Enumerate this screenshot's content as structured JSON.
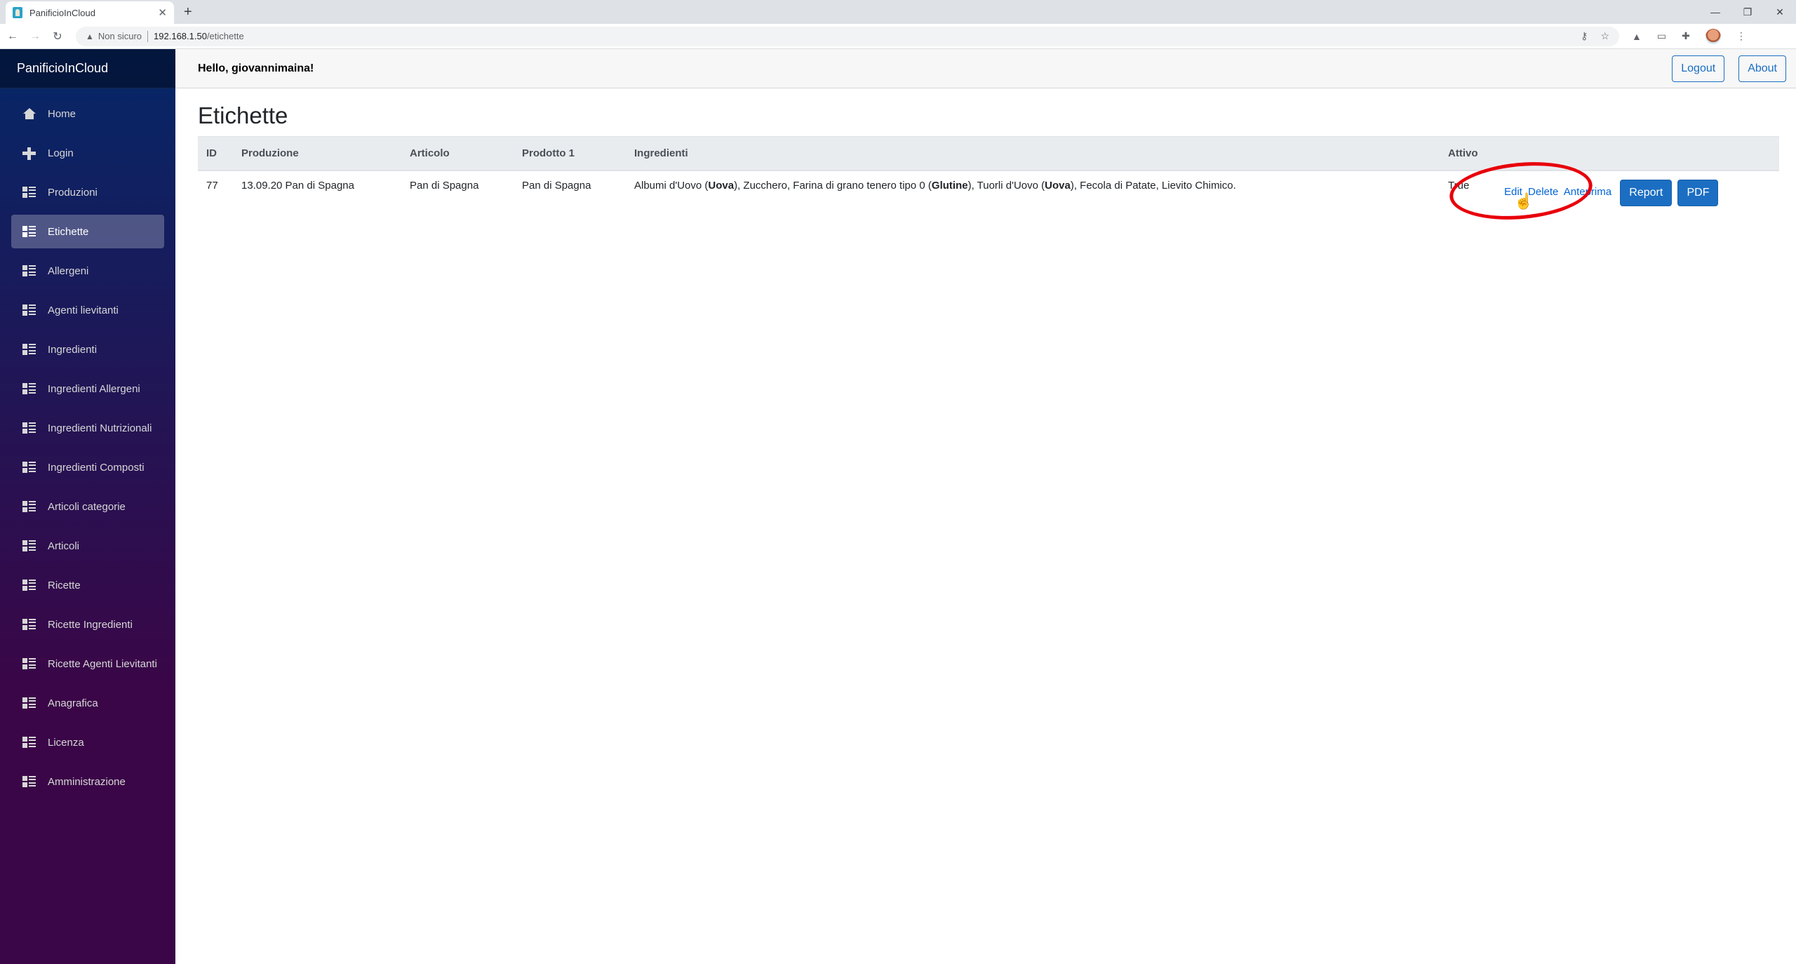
{
  "browser": {
    "tab_title": "PanificioInCloud",
    "new_tab": "+",
    "security_label": "Non sicuro",
    "url_host": "192.168.1.50",
    "url_path": "/etichette",
    "icons": [
      "key-icon",
      "star-icon",
      "drive-icon",
      "cast-icon",
      "extensions-icon",
      "profile-avatar",
      "menu-dots-icon"
    ]
  },
  "sidebar": {
    "brand": "PanificioInCloud",
    "items": [
      {
        "label": "Home",
        "icon": "home-icon",
        "active": false
      },
      {
        "label": "Login",
        "icon": "plus-icon",
        "active": false
      },
      {
        "label": "Produzioni",
        "icon": "list-icon",
        "active": false
      },
      {
        "label": "Etichette",
        "icon": "list-icon",
        "active": true
      },
      {
        "label": "Allergeni",
        "icon": "list-icon",
        "active": false
      },
      {
        "label": "Agenti lievitanti",
        "icon": "list-icon",
        "active": false
      },
      {
        "label": "Ingredienti",
        "icon": "list-icon",
        "active": false
      },
      {
        "label": "Ingredienti Allergeni",
        "icon": "list-icon",
        "active": false
      },
      {
        "label": "Ingredienti Nutrizionali",
        "icon": "list-icon",
        "active": false
      },
      {
        "label": "Ingredienti Composti",
        "icon": "list-icon",
        "active": false
      },
      {
        "label": "Articoli categorie",
        "icon": "list-icon",
        "active": false
      },
      {
        "label": "Articoli",
        "icon": "list-icon",
        "active": false
      },
      {
        "label": "Ricette",
        "icon": "list-icon",
        "active": false
      },
      {
        "label": "Ricette Ingredienti",
        "icon": "list-icon",
        "active": false
      },
      {
        "label": "Ricette Agenti Lievitanti",
        "icon": "list-icon",
        "active": false
      },
      {
        "label": "Anagrafica",
        "icon": "list-icon",
        "active": false
      },
      {
        "label": "Licenza",
        "icon": "list-icon",
        "active": false
      },
      {
        "label": "Amministrazione",
        "icon": "list-icon",
        "active": false
      }
    ]
  },
  "header": {
    "greeting": "Hello, giovannimaina!",
    "logout": "Logout",
    "about": "About"
  },
  "main": {
    "title": "Etichette",
    "table": {
      "columns": [
        "ID",
        "Produzione",
        "Articolo",
        "Prodotto 1",
        "Ingredienti",
        "Attivo",
        ""
      ],
      "rows": [
        {
          "id": "77",
          "produzione": "13.09.20 Pan di Spagna",
          "articolo": "Pan di Spagna",
          "prodotto1": "Pan di Spagna",
          "ingredienti": [
            {
              "text": "Albumi d'Uovo (",
              "bold": false
            },
            {
              "text": "Uova",
              "bold": true
            },
            {
              "text": "), Zucchero, Farina di grano tenero tipo 0 (",
              "bold": false
            },
            {
              "text": "Glutine",
              "bold": true
            },
            {
              "text": "), Tuorli d'Uovo (",
              "bold": false
            },
            {
              "text": "Uova",
              "bold": true
            },
            {
              "text": "), Fecola di Patate, Lievito Chimico.",
              "bold": false
            }
          ],
          "attivo": "True",
          "actions": {
            "edit": "Edit",
            "delete": "Delete",
            "preview": "Anteprima",
            "report": "Report",
            "pdf": "PDF"
          }
        }
      ]
    }
  },
  "colors": {
    "primary": "#1b6ec2",
    "link": "#0366d6",
    "annotation": "#e8000b",
    "sidebar_top": "#052767",
    "sidebar_bottom": "#3a0647"
  }
}
